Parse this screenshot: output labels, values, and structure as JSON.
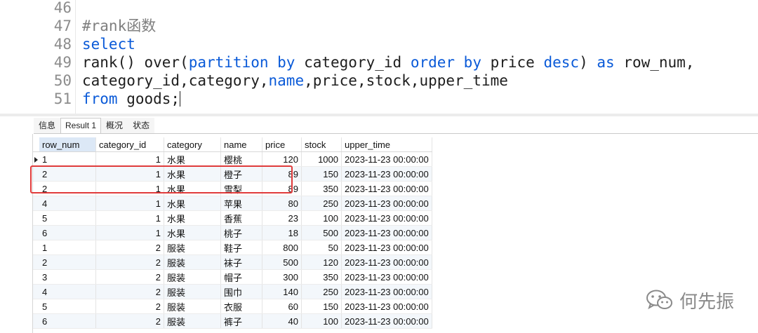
{
  "editor": {
    "lines": [
      {
        "n": "46",
        "parts": []
      },
      {
        "n": "47",
        "parts": [
          {
            "t": "#rank函数",
            "c": "cm"
          }
        ]
      },
      {
        "n": "48",
        "parts": [
          {
            "t": "select",
            "c": "kw"
          }
        ]
      },
      {
        "n": "49",
        "parts": [
          {
            "t": "rank() over(",
            "c": "fn"
          },
          {
            "t": "partition by",
            "c": "kw"
          },
          {
            "t": " category_id ",
            "c": "fn"
          },
          {
            "t": "order by",
            "c": "kw"
          },
          {
            "t": " price ",
            "c": "fn"
          },
          {
            "t": "desc",
            "c": "kw"
          },
          {
            "t": ") ",
            "c": "fn"
          },
          {
            "t": "as",
            "c": "kw"
          },
          {
            "t": " row_num,",
            "c": "fn"
          }
        ]
      },
      {
        "n": "50",
        "parts": [
          {
            "t": "category_id,category,",
            "c": "fn"
          },
          {
            "t": "name",
            "c": "kw"
          },
          {
            "t": ",price,stock,upper_time",
            "c": "fn"
          }
        ]
      },
      {
        "n": "51",
        "parts": [
          {
            "t": "from",
            "c": "kw"
          },
          {
            "t": " goods;",
            "c": "fn"
          }
        ],
        "caret": true
      }
    ]
  },
  "tabs": [
    {
      "label": "信息",
      "active": false
    },
    {
      "label": "Result 1",
      "active": true
    },
    {
      "label": "概况",
      "active": false
    },
    {
      "label": "状态",
      "active": false
    }
  ],
  "grid": {
    "columns": [
      "row_num",
      "category_id",
      "category",
      "name",
      "price",
      "stock",
      "upper_time"
    ],
    "rows": [
      [
        "1",
        "1",
        "水果",
        "樱桃",
        "120",
        "1000",
        "2023-11-23 00:00:00"
      ],
      [
        "2",
        "1",
        "水果",
        "橙子",
        "89",
        "150",
        "2023-11-23 00:00:00"
      ],
      [
        "2",
        "1",
        "水果",
        "雪梨",
        "89",
        "350",
        "2023-11-23 00:00:00"
      ],
      [
        "4",
        "1",
        "水果",
        "苹果",
        "80",
        "250",
        "2023-11-23 00:00:00"
      ],
      [
        "5",
        "1",
        "水果",
        "香蕉",
        "23",
        "100",
        "2023-11-23 00:00:00"
      ],
      [
        "6",
        "1",
        "水果",
        "桃子",
        "18",
        "500",
        "2023-11-23 00:00:00"
      ],
      [
        "1",
        "2",
        "服装",
        "鞋子",
        "800",
        "50",
        "2023-11-23 00:00:00"
      ],
      [
        "2",
        "2",
        "服装",
        "袜子",
        "500",
        "120",
        "2023-11-23 00:00:00"
      ],
      [
        "3",
        "2",
        "服装",
        "帽子",
        "300",
        "350",
        "2023-11-23 00:00:00"
      ],
      [
        "4",
        "2",
        "服装",
        "围巾",
        "140",
        "250",
        "2023-11-23 00:00:00"
      ],
      [
        "5",
        "2",
        "服装",
        "衣服",
        "60",
        "150",
        "2023-11-23 00:00:00"
      ],
      [
        "6",
        "2",
        "服装",
        "裤子",
        "40",
        "100",
        "2023-11-23 00:00:00"
      ]
    ],
    "current_row_marker": "row-pointer-icon"
  },
  "watermark": {
    "text": "何先振",
    "icon": "wechat-icon"
  },
  "colors": {
    "keyword": "#0a5ad8",
    "highlight": "#e03b3b",
    "alt_row": "#f3f7fb"
  }
}
